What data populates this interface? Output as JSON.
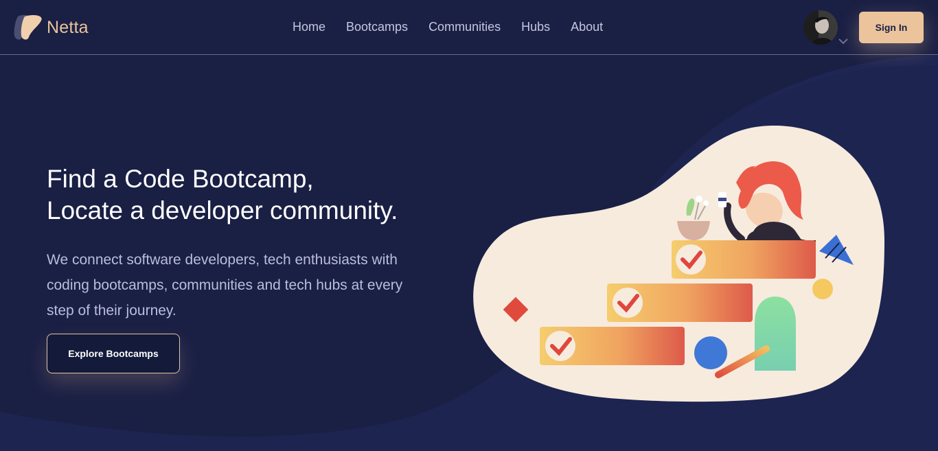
{
  "app": {
    "name": "Netta"
  },
  "nav": {
    "items": [
      "Home",
      "Bootcamps",
      "Communities",
      "Hubs",
      "About"
    ]
  },
  "header": {
    "sign_in_label": "Sign In"
  },
  "hero": {
    "title_line1": "Find a Code Bootcamp,",
    "title_line2": "Locate a developer community.",
    "subtitle": "We connect software developers, tech enthusiasts with coding bootcamps, communities and tech hubs at every step of their journey.",
    "cta_label": "Explore Bootcamps"
  },
  "colors": {
    "background": "#1a1f44",
    "accent": "#ecc49c",
    "blob": "#f7ebde"
  },
  "icons": [
    "netta-logo-icon",
    "user-avatar",
    "chevron-down-icon"
  ]
}
